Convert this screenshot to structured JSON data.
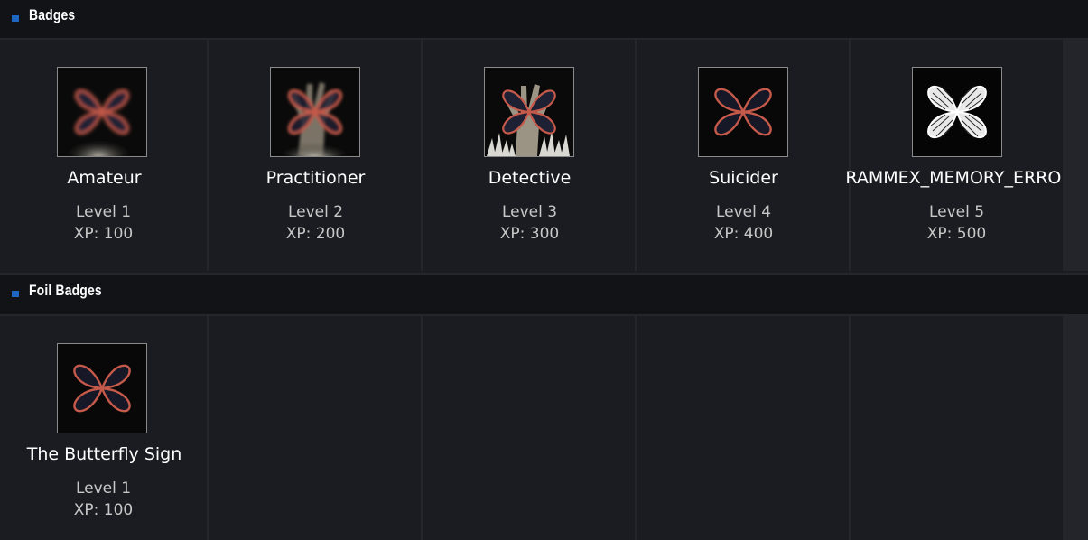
{
  "sections": [
    {
      "title": "Badges",
      "badges": [
        {
          "name": "Amateur",
          "level": "Level 1",
          "xp": "XP: 100",
          "icon": "butterfly-badge-icon-blurred"
        },
        {
          "name": "Practitioner",
          "level": "Level 2",
          "xp": "XP: 200",
          "icon": "butterfly-hand-badge-icon"
        },
        {
          "name": "Detective",
          "level": "Level 3",
          "xp": "XP: 300",
          "icon": "butterfly-hand-crystals-badge-icon"
        },
        {
          "name": "Suicider",
          "level": "Level 4",
          "xp": "XP: 400",
          "icon": "butterfly-badge-icon"
        },
        {
          "name": "RAMMEX_MEMORY_ERROR",
          "level": "Level 5",
          "xp": "XP: 500",
          "icon": "white-butterfly-badge-icon"
        }
      ]
    },
    {
      "title": "Foil Badges",
      "badges": [
        {
          "name": "The Butterfly Sign",
          "level": "Level 1",
          "xp": "XP: 100",
          "icon": "foil-butterfly-badge-icon"
        }
      ]
    }
  ],
  "colors": {
    "accent": "#1e66c4",
    "butterfly_red": "#c65a4a",
    "background": "#1b1c21",
    "header": "#121317"
  }
}
